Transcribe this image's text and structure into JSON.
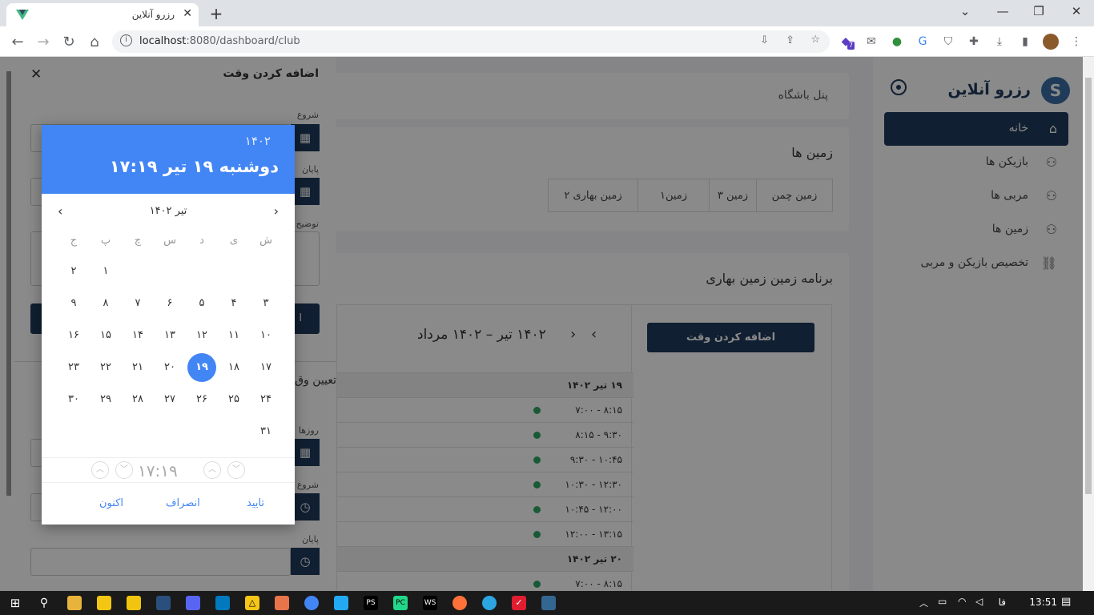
{
  "browser": {
    "tab_title": "رزرو آنلاین",
    "tab_close": "✕",
    "new_tab": "+",
    "url_host": "localhost",
    "url_rest": ":8080/dashboard/club",
    "win_min": "⌄",
    "win_min2": "—",
    "win_max": "❐",
    "win_close": "✕",
    "ext_badge": "7"
  },
  "sidebar": {
    "brand": "رزرو آنلاین",
    "items": [
      {
        "label": "خانه",
        "icon": "home-icon"
      },
      {
        "label": "بازیکن ها",
        "icon": "users-icon"
      },
      {
        "label": "مربی ها",
        "icon": "users-icon"
      },
      {
        "label": "زمین ها",
        "icon": "users-icon"
      },
      {
        "label": "تخصیص بازیکن و مربی",
        "icon": "link-icon"
      }
    ]
  },
  "main": {
    "panel_title": "پنل باشگاه",
    "fields_title": "زمین ها",
    "fields": [
      "زمین چمن",
      "زمین ۳",
      "زمین۱",
      "زمین بهاری ۲"
    ],
    "schedule_title": "برنامه زمین زمین بهاری",
    "add_time_button": "اضافه کردن وقت",
    "range_label": "۱۴۰۲ تیر – ۱۴۰۲ مرداد",
    "schedule": [
      {
        "type": "head",
        "text": "۱۹ تیر ۱۴۰۲"
      },
      {
        "type": "slot",
        "text": "۷:۰۰ - ۸:۱۵"
      },
      {
        "type": "slot",
        "text": "۸:۱۵ - ۹:۳۰"
      },
      {
        "type": "slot",
        "text": "۹:۳۰ - ۱۰:۴۵"
      },
      {
        "type": "slot",
        "text": "۱۰:۳۰ - ۱۲:۳۰"
      },
      {
        "type": "slot",
        "text": "۱۰:۴۵ - ۱۲:۰۰"
      },
      {
        "type": "slot",
        "text": "۱۲:۰۰ - ۱۳:۱۵"
      },
      {
        "type": "head",
        "text": "۲۰ تیر ۱۴۰۲"
      },
      {
        "type": "slot",
        "text": "۷:۰۰ - ۸:۱۵"
      }
    ]
  },
  "drawer": {
    "title": "اضافه کردن وقت",
    "close": "✕",
    "label_start": "شروع",
    "label_end": "پایان",
    "label_desc": "توضیح",
    "section_assign": "تعیین وق",
    "label_days": "روزها",
    "label_start2": "شروع",
    "label_end2": "پایان",
    "button_partial": "ا"
  },
  "datepicker": {
    "year": "۱۴۰۲",
    "selected_full": "دوشنبه ۱۹ تیر ۱۷:۱۹",
    "month_label": "تیر ۱۴۰۲",
    "weekdays": [
      "ش",
      "ی",
      "د",
      "س",
      "چ",
      "پ",
      "ج"
    ],
    "weeks": [
      [
        "",
        "",
        "",
        "",
        "",
        "۱",
        "۲"
      ],
      [
        "۳",
        "۴",
        "۵",
        "۶",
        "۷",
        "۸",
        "۹"
      ],
      [
        "۱۰",
        "۱۱",
        "۱۲",
        "۱۳",
        "۱۴",
        "۱۵",
        "۱۶"
      ],
      [
        "۱۷",
        "۱۸",
        "۱۹",
        "۲۰",
        "۲۱",
        "۲۲",
        "۲۳"
      ],
      [
        "۲۴",
        "۲۵",
        "۲۶",
        "۲۷",
        "۲۸",
        "۲۹",
        "۳۰"
      ],
      [
        "۳۱",
        "",
        "",
        "",
        "",
        "",
        ""
      ]
    ],
    "selected_day": "۱۹",
    "time": "۱۷:۱۹",
    "confirm": "تایید",
    "cancel": "انصراف",
    "now": "اکنون"
  },
  "taskbar": {
    "lang": "فا",
    "clock": "13:51"
  },
  "colors": {
    "navy": "#1f3a5c",
    "blue": "#4285f4",
    "green": "#2fa665"
  }
}
